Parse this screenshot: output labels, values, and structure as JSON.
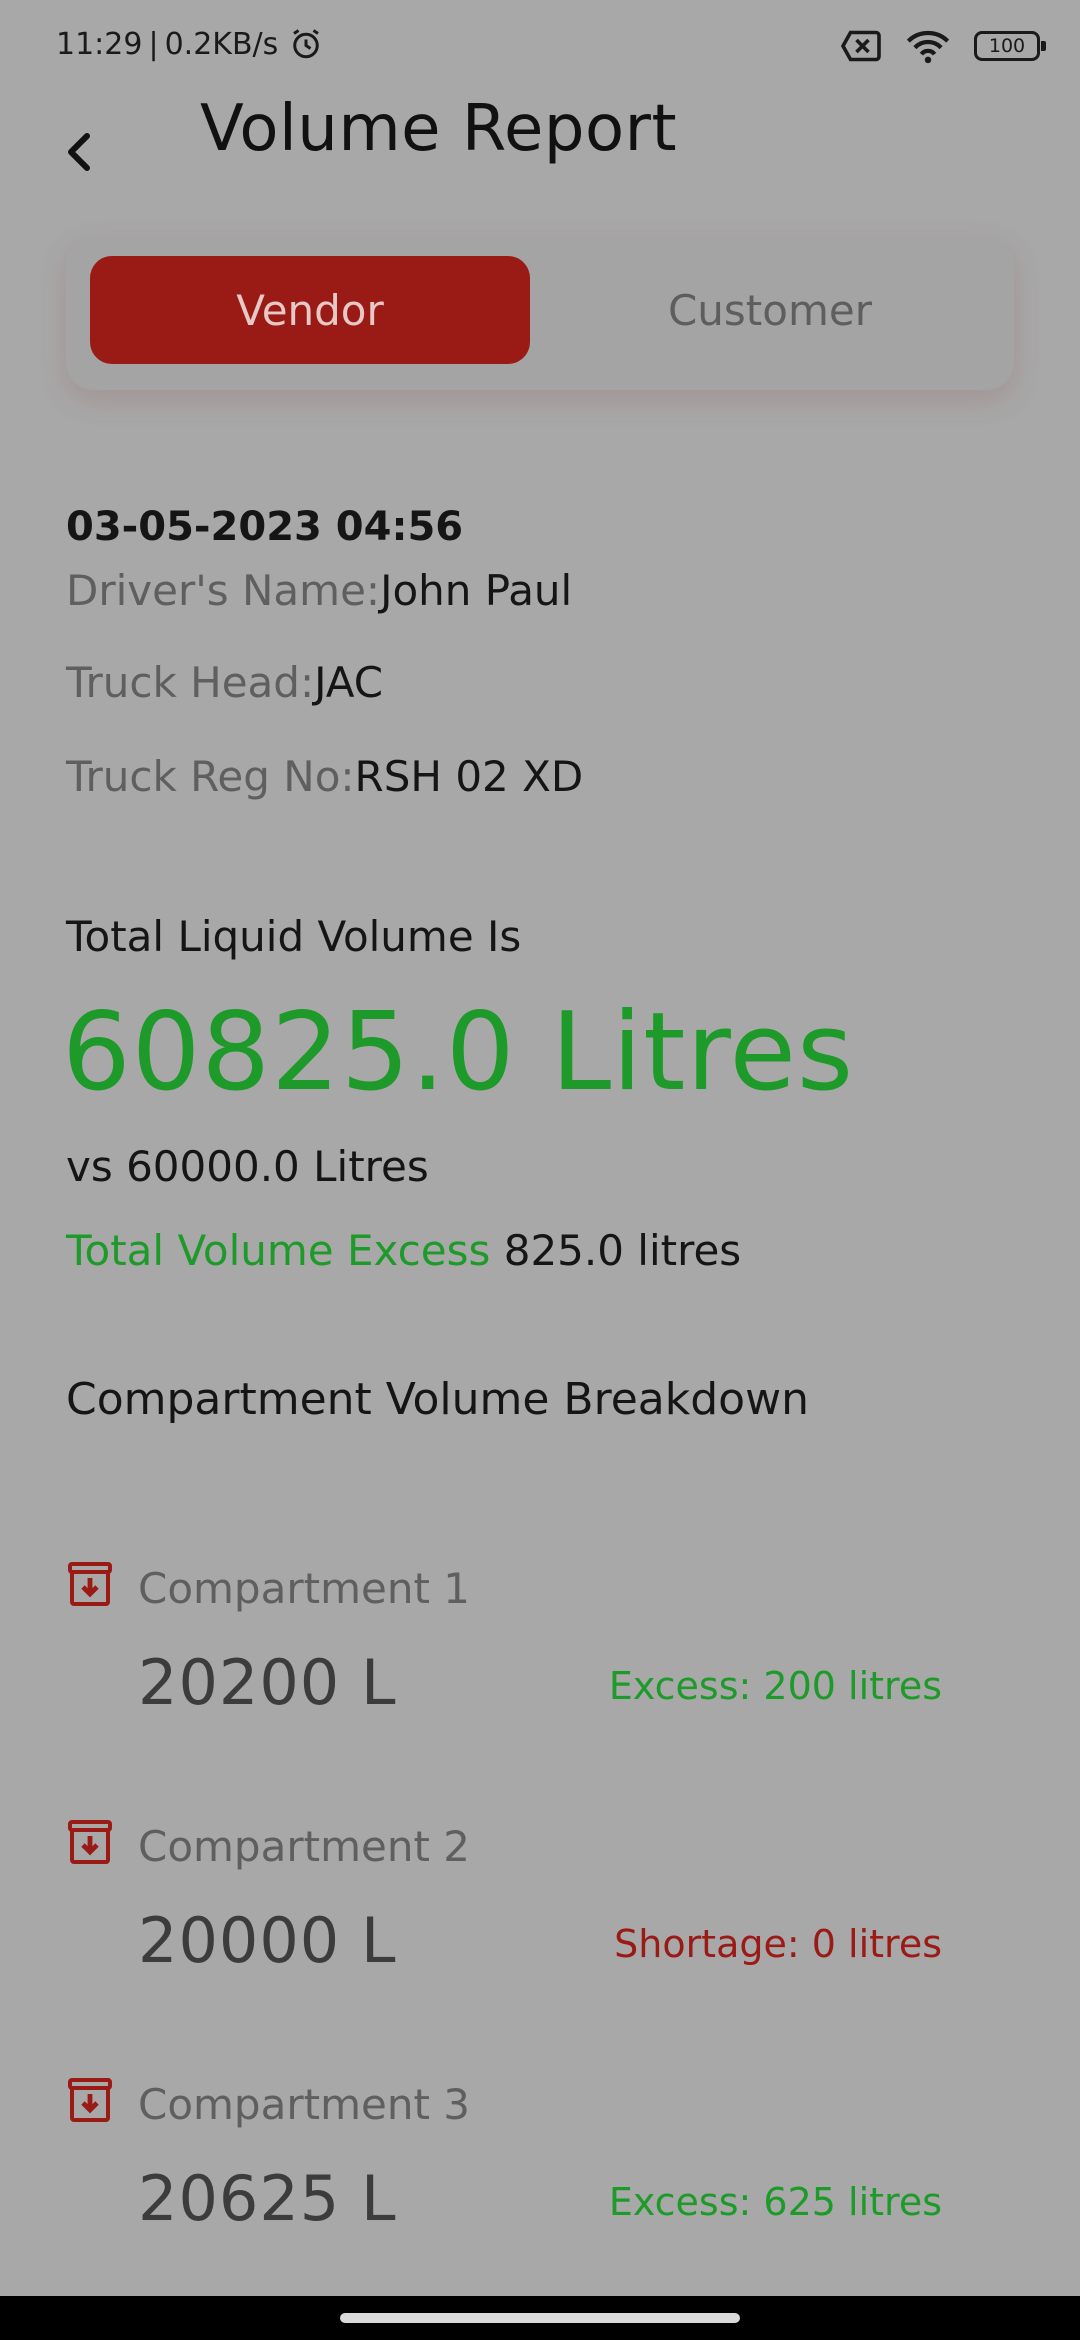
{
  "status_bar": {
    "time": "11:29",
    "separator": "|",
    "net_speed": "0.2KB/s",
    "battery": "100"
  },
  "header": {
    "title": "Volume Report"
  },
  "tabs": [
    {
      "label": "Vendor",
      "active": true
    },
    {
      "label": "Customer",
      "active": false
    }
  ],
  "record": {
    "datetime": "03-05-2023 04:56",
    "driver_label": "Driver's Name:",
    "driver_value": "John Paul",
    "truck_head_label": "Truck Head:",
    "truck_head_value": "JAC",
    "reg_label": "Truck Reg No:",
    "reg_value": "RSH 02 XD"
  },
  "totals": {
    "label": "Total Liquid Volume Is",
    "value": "60825.0 Litres",
    "versus": "vs 60000.0 Litres",
    "excess_label": "Total Volume Excess",
    "excess_value": "825.0 litres"
  },
  "breakdown": {
    "title": "Compartment Volume Breakdown",
    "compartments": [
      {
        "name": "Compartment 1",
        "volume": "20200 L",
        "status": "Excess: 200 litres",
        "kind": "excess"
      },
      {
        "name": "Compartment 2",
        "volume": "20000 L",
        "status": "Shortage: 0 litres",
        "kind": "shortage"
      },
      {
        "name": "Compartment 3",
        "volume": "20625 L",
        "status": "Excess: 625 litres",
        "kind": "excess"
      }
    ]
  },
  "colors": {
    "brand_red": "#9a1a16",
    "success_green": "#1e9a2a",
    "overlay_gray": "#a8a8a8"
  },
  "icons": {
    "back": "chevron-left-icon",
    "alarm": "alarm-clock-icon",
    "sim": "sim-x-icon",
    "wifi": "wifi-icon",
    "battery": "battery-icon",
    "compartment": "archive-download-icon"
  }
}
